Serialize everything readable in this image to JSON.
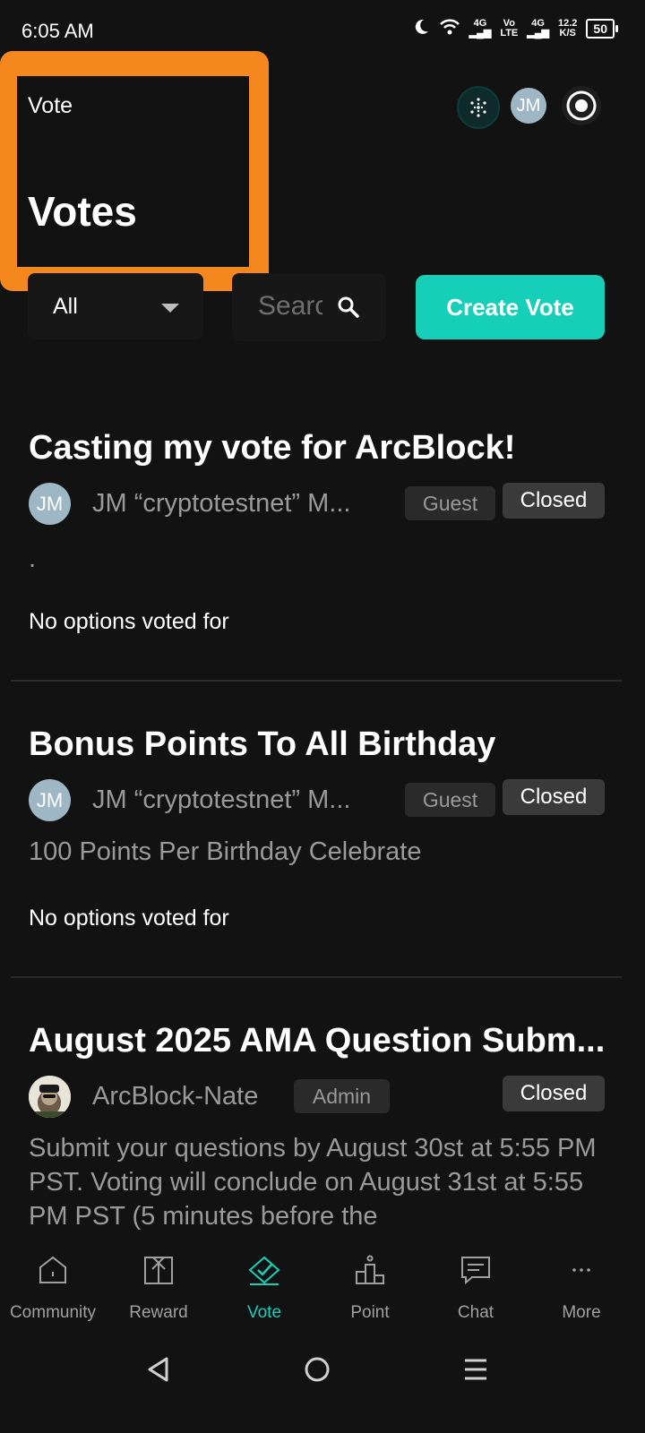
{
  "status_bar": {
    "time": "6:05 AM",
    "net_speed": "12.2",
    "net_unit": "K/S",
    "battery": "50",
    "sig1": "4G",
    "sig2_top": "Vo",
    "sig2_bottom": "LTE",
    "sig3": "4G"
  },
  "header": {
    "breadcrumb": "Vote",
    "title": "Votes",
    "avatar_initials": "JM"
  },
  "filter": {
    "selected": "All",
    "search_placeholder": "Search"
  },
  "create_button": "Create Vote",
  "votes": [
    {
      "title": "Casting my vote for ArcBlock!",
      "author_initials": "JM",
      "author": "JM “cryptotestnet” M...",
      "role": "Guest",
      "status": "Closed",
      "description": ".",
      "voted": "No options voted for"
    },
    {
      "title": "Bonus Points To All Birthday",
      "author_initials": "JM",
      "author": "JM “cryptotestnet” M...",
      "role": "Guest",
      "status": "Closed",
      "description": "100 Points Per Birthday Celebrate",
      "voted": "No options voted for"
    },
    {
      "title": "August 2025 AMA Question Subm...",
      "author": "ArcBlock-Nate",
      "role": "Admin",
      "status": "Closed",
      "description": "Submit your questions by August 30st at 5:55 PM PST. Voting will conclude on August 31st at 5:55 PM PST (5 minutes before the"
    }
  ],
  "nav": [
    {
      "label": "Community",
      "icon": "home-icon"
    },
    {
      "label": "Reward",
      "icon": "gift-icon"
    },
    {
      "label": "Vote",
      "icon": "vote-icon",
      "active": true
    },
    {
      "label": "Point",
      "icon": "podium-icon"
    },
    {
      "label": "Chat",
      "icon": "chat-icon"
    },
    {
      "label": "More",
      "icon": "more-icon"
    }
  ],
  "colors": {
    "accent": "#16cfb8",
    "highlight": "#f5871f",
    "background": "#121212"
  }
}
